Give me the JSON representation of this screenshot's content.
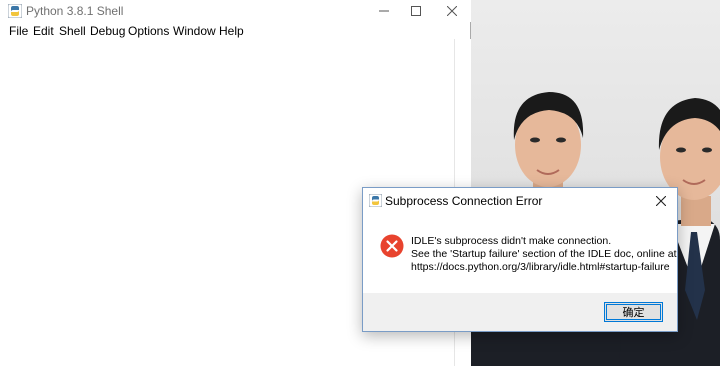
{
  "shell": {
    "title": "Python 3.8.1 Shell",
    "menu": [
      "File",
      "Edit",
      "Shell",
      "Debug",
      "Options",
      "Window",
      "Help"
    ]
  },
  "dialog": {
    "title": "Subprocess Connection Error",
    "message": [
      "IDLE's subprocess didn't make connection.",
      "See the 'Startup failure' section of the IDLE doc, online at",
      "https://docs.python.org/3/library/idle.html#startup-failure"
    ],
    "ok_label": "确定",
    "icon": "error-icon"
  }
}
